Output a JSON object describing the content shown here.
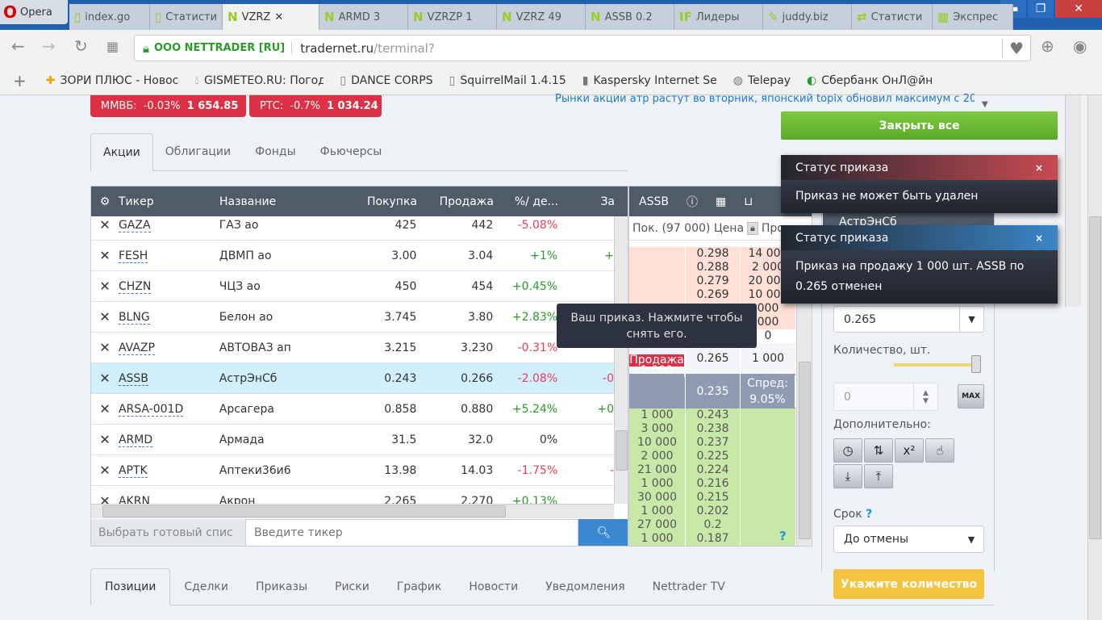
{
  "browser": {
    "name": "Opera",
    "tabs": [
      {
        "icon": "page-icon",
        "label": "index.go"
      },
      {
        "icon": "page-icon",
        "label": "Статисти"
      },
      {
        "icon": "n-icon",
        "label": "VZRZ",
        "active": true
      },
      {
        "icon": "n-icon",
        "label": "ARMD 3"
      },
      {
        "icon": "n-icon",
        "label": "VZRZP 1"
      },
      {
        "icon": "n-icon",
        "label": "VZRZ 49"
      },
      {
        "icon": "n-icon",
        "label": "ASSB 0.2"
      },
      {
        "icon": "if-icon",
        "label": "Лидеры"
      },
      {
        "icon": "carrot-icon",
        "label": "juddy.biz"
      },
      {
        "icon": "arrows-icon",
        "label": "Статисти"
      },
      {
        "icon": "grid-icon",
        "label": "Экспрес"
      }
    ],
    "site_identity": "ООО NETTRADER [RU]",
    "url_host": "tradernet.ru",
    "url_path": "/terminal?",
    "bookmarks": [
      "ЗОРИ ПЛЮС - Новос",
      "GISMETEO.RU: Погод",
      "DANCE CORPS",
      "SquirrelMail 1.4.15",
      "Kaspersky Internet Se",
      "Telepay",
      "Сбербанк ОнЛ@йн"
    ]
  },
  "indices": [
    {
      "name": "ММВБ:",
      "change": "-0.03%",
      "value": "1 654.85"
    },
    {
      "name": "РТС:",
      "change": "-0.7%",
      "value": "1 034.24"
    }
  ],
  "news": "Рынки акции атр растут во вторник, японский topix обновил максимум с 20...",
  "close_all": "Закрыть все",
  "market_tabs": [
    "Акции",
    "Облигации",
    "Фонды",
    "Фьючерсы"
  ],
  "table": {
    "headers": [
      "Тикер",
      "Название",
      "Покупка",
      "Продажа",
      "%/ де...",
      "За"
    ],
    "rows": [
      [
        "GAZA",
        "ГАЗ ао",
        "425",
        "442",
        "-5.08%",
        ""
      ],
      [
        "FESH",
        "ДВМП ао",
        "3.00",
        "3.04",
        "+1%",
        "+"
      ],
      [
        "CHZN",
        "ЧЦЗ ао",
        "450",
        "454",
        "+0.45%",
        ""
      ],
      [
        "BLNG",
        "Белон ао",
        "3.745",
        "3.80",
        "+2.83%",
        ""
      ],
      [
        "AVAZP",
        "АВТОВАЗ ап",
        "3.215",
        "3.230",
        "-0.31%",
        ""
      ],
      [
        "ASSB",
        "АстрЭнСб",
        "0.243",
        "0.266",
        "-2.08%",
        "-0"
      ],
      [
        "ARSA-001D",
        "Арсагера",
        "0.858",
        "0.880",
        "+5.24%",
        "+0"
      ],
      [
        "ARMD",
        "Армада",
        "31.5",
        "32.0",
        "0%",
        ""
      ],
      [
        "APTK",
        "Аптеки36и6",
        "13.98",
        "14.03",
        "-1.75%",
        "-"
      ],
      [
        "AKRN",
        "Акрон",
        "2.265",
        "2.270",
        "+0.13%",
        ""
      ]
    ],
    "selected_row": 5,
    "list_select": "Выбрать готовый спис",
    "ticker_placeholder": "Введите тикер"
  },
  "orderbook": {
    "ticker": "ASSB",
    "sub_buy": "Пок. (97 000)",
    "sub_price": "Цена",
    "sub_sell": "Про",
    "asks": [
      [
        "0.298",
        "14 000"
      ],
      [
        "0.288",
        "2 000"
      ],
      [
        "0.279",
        "20 000"
      ],
      [
        "0.269",
        "10 000"
      ],
      [
        "",
        "000"
      ],
      [
        "",
        "000"
      ]
    ],
    "mid_row": "0",
    "my_order_label": "Продажа",
    "my_order_qty": "1 000",
    "my_order_price": "0.265",
    "my_order_size": "1 000",
    "last": "0.235",
    "spread_label": "Спред:",
    "spread": "9.05%",
    "bids": [
      [
        "1 000",
        "0.243"
      ],
      [
        "3 000",
        "0.238"
      ],
      [
        "10 000",
        "0.237"
      ],
      [
        "2 000",
        "0.225"
      ],
      [
        "21 000",
        "0.224"
      ],
      [
        "1 000",
        "0.216"
      ],
      [
        "30 000",
        "0.215"
      ],
      [
        "1 000",
        "0.202"
      ],
      [
        "27 000",
        "0.2"
      ],
      [
        "1 000",
        "0.187"
      ]
    ]
  },
  "tooltip": "Ваш приказ. Нажмите чтобы снять его.",
  "notifications": [
    {
      "title": "Статус приказа",
      "text": "Приказ не может быть удален",
      "color": "#c84a52"
    },
    {
      "title": "Статус приказа",
      "text": "Приказ на продажу 1 000 шт. ASSB по 0.265 отменен",
      "color": "#3a86c8"
    }
  ],
  "order_form": {
    "instrument": "АстрЭнСб",
    "price": "0.265",
    "qty_label": "Количество, шт.",
    "slider_level": 1.0,
    "qty": "0",
    "max": "MAX",
    "extra_label": "Дополнительно:",
    "term_label": "Срок",
    "term": "До отмены",
    "submit": "Укажите количество"
  },
  "bottom_tabs": [
    "Позиции",
    "Сделки",
    "Приказы",
    "Риски",
    "График",
    "Новости",
    "Уведомления",
    "Nettrader TV"
  ]
}
